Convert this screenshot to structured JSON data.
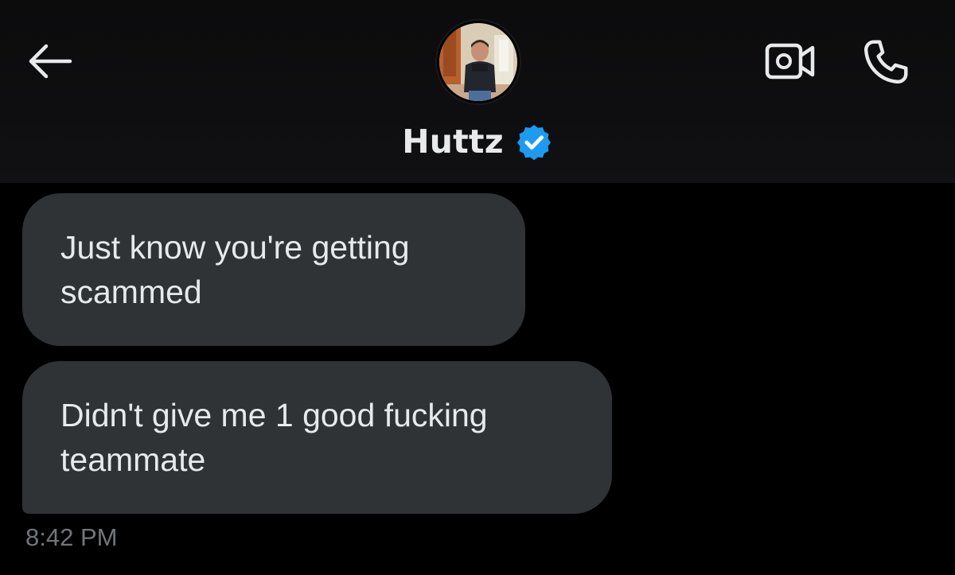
{
  "header": {
    "contact_name": "Huttz",
    "verified": true,
    "back_icon": "arrow-left-icon",
    "video_icon": "video-camera-icon",
    "call_icon": "phone-icon",
    "verified_color": "#1d9bf0"
  },
  "messages": [
    {
      "text": "Just know you're getting\nscammed"
    },
    {
      "text": "Didn't give me 1 good fucking\nteammate"
    }
  ],
  "timestamp": "8:42 PM",
  "colors": {
    "background": "#000000",
    "bubble": "#2f3336",
    "text": "#e7e9ea",
    "muted_text": "#71767b"
  }
}
